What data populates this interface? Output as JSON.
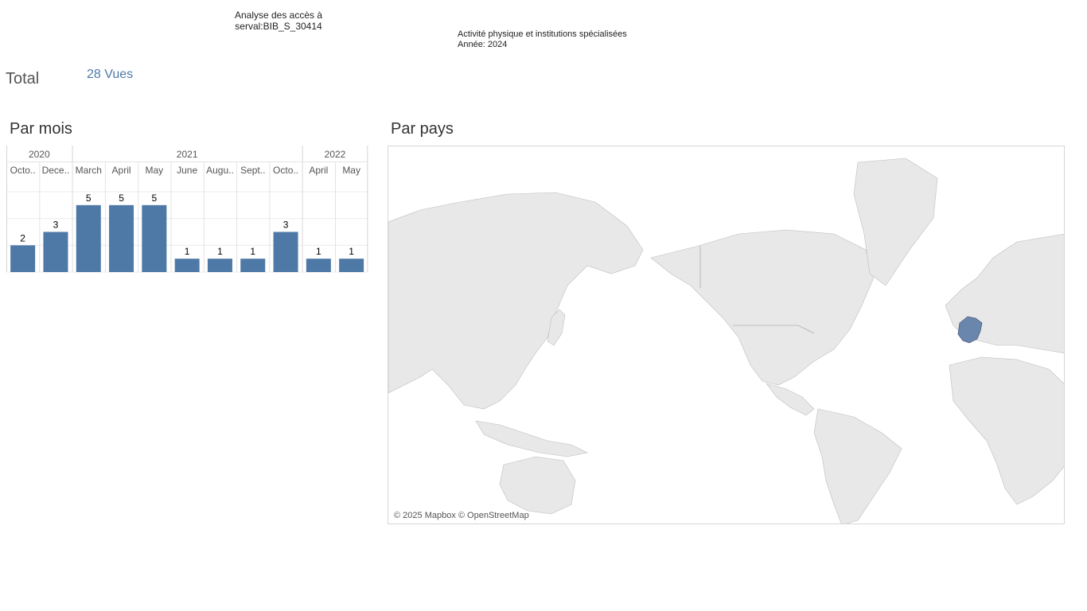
{
  "header": {
    "title_line1": "Analyse des accès à",
    "title_line2": "serval:BIB_S_30414",
    "subtitle_line1": "Activité physique et institutions spécialisées",
    "subtitle_line2": "Année: 2024"
  },
  "total": {
    "label": "Total",
    "value": "28 Vues"
  },
  "sections": {
    "by_month": "Par mois",
    "by_country": "Par pays"
  },
  "colors": {
    "bar": "#4e79a7",
    "highlight_country": "#6b86ad",
    "land": "#e8e8e8",
    "border": "#9a9a9a"
  },
  "map": {
    "attribution": "© 2025 Mapbox © OpenStreetMap",
    "highlighted_country": "France"
  },
  "chart_data": {
    "type": "bar",
    "years": [
      {
        "label": "2020",
        "span": 2
      },
      {
        "label": "2021",
        "span": 7
      },
      {
        "label": "2022",
        "span": 2
      }
    ],
    "categories": [
      "Octo..",
      "Dece..",
      "March",
      "April",
      "May",
      "June",
      "Augu..",
      "Sept..",
      "Octo..",
      "April",
      "May"
    ],
    "values": [
      2,
      3,
      5,
      5,
      5,
      1,
      1,
      1,
      3,
      1,
      1
    ],
    "ylim": [
      0,
      6
    ],
    "grid": true
  }
}
